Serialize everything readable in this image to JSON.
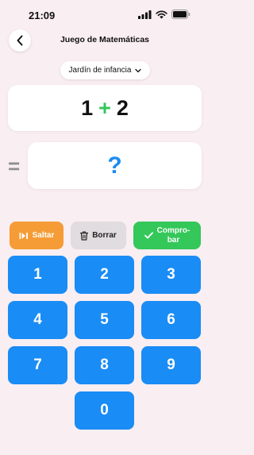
{
  "status": {
    "time": "21:09"
  },
  "nav": {
    "title": "Juego de Matemáticas"
  },
  "level": {
    "selected": "Jardín de infancia"
  },
  "problem": {
    "operand1": "1",
    "operator": "+",
    "operand2": "2"
  },
  "equals": "=",
  "answer": {
    "value": "?"
  },
  "actions": {
    "skip_label": "Saltar",
    "clear_label": "Borrar",
    "check_label_line1": "Compro-",
    "check_label_line2": "bar"
  },
  "keypad": [
    "1",
    "2",
    "3",
    "4",
    "5",
    "6",
    "7",
    "8",
    "9",
    "0"
  ],
  "colors": {
    "background": "#f9eef2",
    "keypad": "#1a8cf5",
    "skip": "#f59c36",
    "clear": "#e1dcdf",
    "check": "#34c759",
    "operator": "#34c759",
    "answer": "#1a8cf0"
  },
  "icons": {
    "back": "chevron-left-icon",
    "select": "chevron-down-icon",
    "skip": "skip-forward-icon",
    "clear": "trash-icon",
    "check": "checkmark-icon",
    "signal": "signal-bars-icon",
    "wifi": "wifi-icon",
    "battery": "battery-icon"
  }
}
